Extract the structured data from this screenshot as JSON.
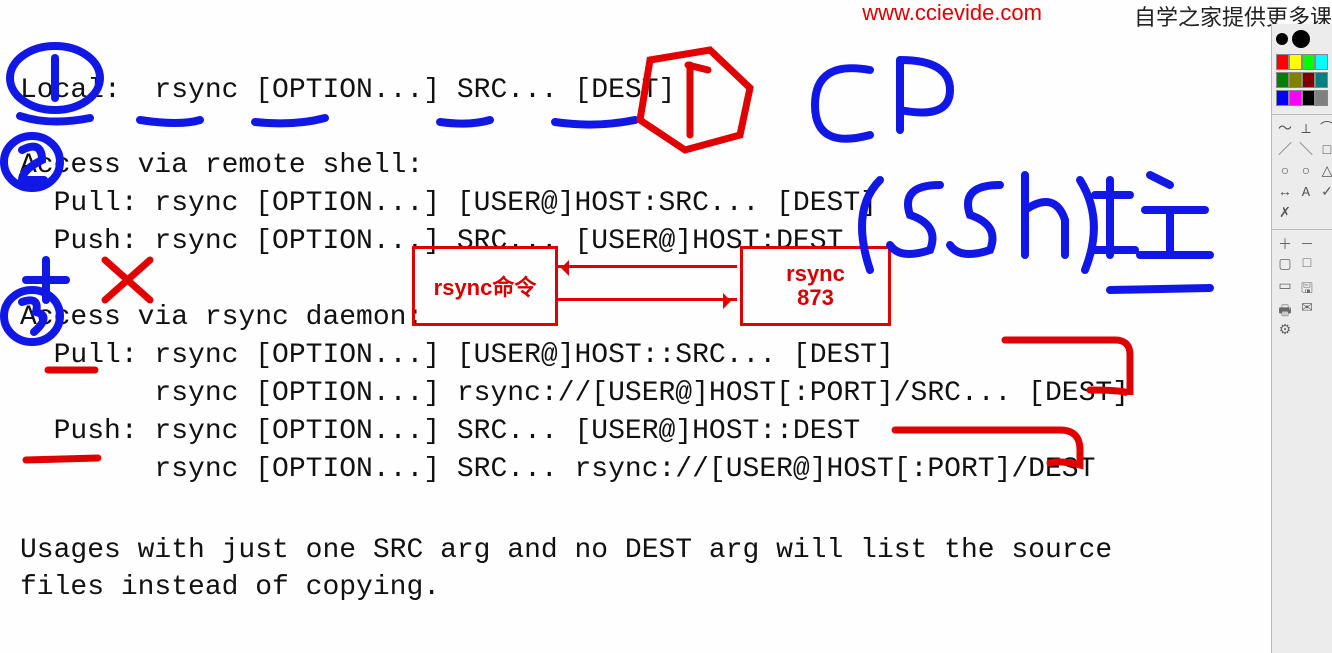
{
  "watermark": {
    "url": "www.ccievide.com",
    "tag": "自学之家提供更多课"
  },
  "lines": {
    "l1": "Local:  rsync [OPTION...] SRC... [DEST]",
    "l2": "Access via remote shell:",
    "l3": "  Pull: rsync [OPTION...] [USER@]HOST:SRC... [DEST]",
    "l4": "  Push: rsync [OPTION...] SRC... [USER@]HOST:DEST",
    "l5": "Access via rsync daemon:",
    "l6": "  Pull: rsync [OPTION...] [USER@]HOST::SRC... [DEST]",
    "l7": "        rsync [OPTION...] rsync://[USER@]HOST[:PORT]/SRC... [DEST]",
    "l8": "  Push: rsync [OPTION...] SRC... [USER@]HOST::DEST",
    "l9": "        rsync [OPTION...] SRC... rsync://[USER@]HOST[:PORT]/DEST",
    "l10a": "Usages with just one SRC arg and no DEST arg will list the source",
    "l10b": "files instead of copying."
  },
  "annotations": {
    "box1": "rsync命令",
    "box2": "rsync\n873",
    "blue_cp": "CP",
    "blue_ssh": "(SSh)拉"
  },
  "palette": {
    "colors_row1": [
      "#ff0000",
      "#ffff00",
      "#00ff00",
      "#00ffff"
    ],
    "colors_row2": [
      "#008000",
      "#808000",
      "#800000",
      "#008080"
    ],
    "colors_row3": [
      "#0000ff",
      "#ff00ff",
      "#000000",
      "#808080"
    ],
    "tool_glyphs": [
      "～",
      "⟂",
      "⌒",
      "／",
      "＼",
      "□",
      "○",
      "○",
      "△",
      "↔",
      "A",
      "✓",
      "✗",
      "＋",
      "－",
      "▢",
      "□",
      "▭",
      "🖫",
      "🖶",
      "✉",
      "⚙"
    ]
  }
}
